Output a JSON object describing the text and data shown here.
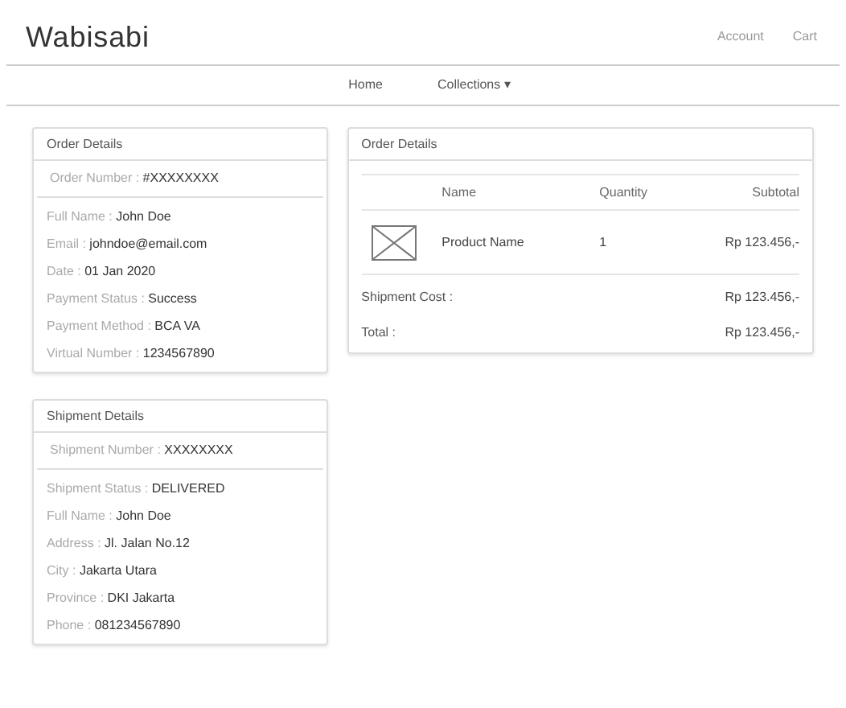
{
  "header": {
    "logo": "Wabisabi",
    "links": [
      "Account",
      "Cart"
    ]
  },
  "nav": [
    {
      "label": "Home"
    },
    {
      "label": "Collections",
      "caret": "▾"
    }
  ],
  "order_details": {
    "title": "Order Details",
    "number": {
      "label": "Order Number :",
      "value": "#XXXXXXXX"
    },
    "fields": [
      {
        "label": "Full Name :",
        "value": "John Doe"
      },
      {
        "label": "Email :",
        "value": "johndoe@email.com"
      },
      {
        "label": "Date :",
        "value": "01 Jan 2020"
      },
      {
        "label": "Payment Status :",
        "value": "Success"
      },
      {
        "label": "Payment Method :",
        "value": "BCA VA"
      },
      {
        "label": "Virtual Number :",
        "value": "1234567890"
      }
    ]
  },
  "items_panel": {
    "title": "Order Details",
    "columns": [
      "Name",
      "Quantity",
      "Subtotal"
    ],
    "rows": [
      {
        "name": "Product Name",
        "quantity": "1",
        "subtotal": "Rp 123.456,-"
      }
    ],
    "summary": [
      {
        "label": "Shipment Cost :",
        "value": "Rp 123.456,-"
      },
      {
        "label": "Total :",
        "value": "Rp 123.456,-"
      }
    ]
  },
  "shipment_details": {
    "title": "Shipment Details",
    "number": {
      "label": "Shipment Number :",
      "value": "XXXXXXXX"
    },
    "fields": [
      {
        "label": "Shipment Status :",
        "value": "DELIVERED"
      },
      {
        "label": "Full Name :",
        "value": "John Doe"
      },
      {
        "label": "Address :",
        "value": "Jl. Jalan No.12"
      },
      {
        "label": "City :",
        "value": "Jakarta Utara"
      },
      {
        "label": "Province :",
        "value": "DKI Jakarta"
      },
      {
        "label": "Phone :",
        "value": "081234567890"
      }
    ]
  }
}
